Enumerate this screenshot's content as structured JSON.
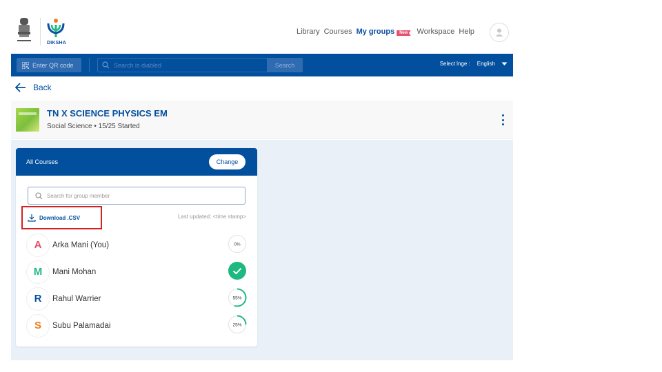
{
  "header": {
    "emblem_caption": "सत्यमेव जयते",
    "logo_text": "DIKSHA",
    "nav": [
      {
        "label": "Library"
      },
      {
        "label": "Courses"
      },
      {
        "label": "My groups",
        "active": true,
        "badge": "New"
      },
      {
        "label": "Workspace"
      },
      {
        "label": "Help"
      }
    ]
  },
  "toolbar": {
    "qr_label": "Enter QR code",
    "search_placeholder": "Search is diabled",
    "search_button": "Search",
    "lang_label": "Select lnge :",
    "lang_value": "English"
  },
  "back_label": "Back",
  "group": {
    "title": "TN X SCIENCE PHYSICS EM",
    "subject": "Social Science",
    "separator": "•",
    "started": "15/25 Started"
  },
  "card": {
    "title": "All Courses",
    "change_label": "Change",
    "search_placeholder": "Search for group member",
    "download_label": "Download .CSV",
    "last_updated": "Last updated: <time stamp>",
    "members": [
      {
        "initial": "A",
        "name": "Arka Mani (You)",
        "progress": 0,
        "progress_label": "0%",
        "color": "#e84e6a",
        "complete": false
      },
      {
        "initial": "M",
        "name": "Mani Mohan",
        "progress": 100,
        "progress_label": "",
        "color": "#1eb980",
        "complete": true
      },
      {
        "initial": "R",
        "name": "Rahul Warrier",
        "progress": 55,
        "progress_label": "55%",
        "color": "#024f9d",
        "complete": false
      },
      {
        "initial": "S",
        "name": "Subu Palamadai",
        "progress": 25,
        "progress_label": "25%",
        "color": "#f07c1b",
        "complete": false
      }
    ]
  },
  "colors": {
    "primary": "#024f9d",
    "success": "#1eb980",
    "highlight": "#d32020"
  }
}
